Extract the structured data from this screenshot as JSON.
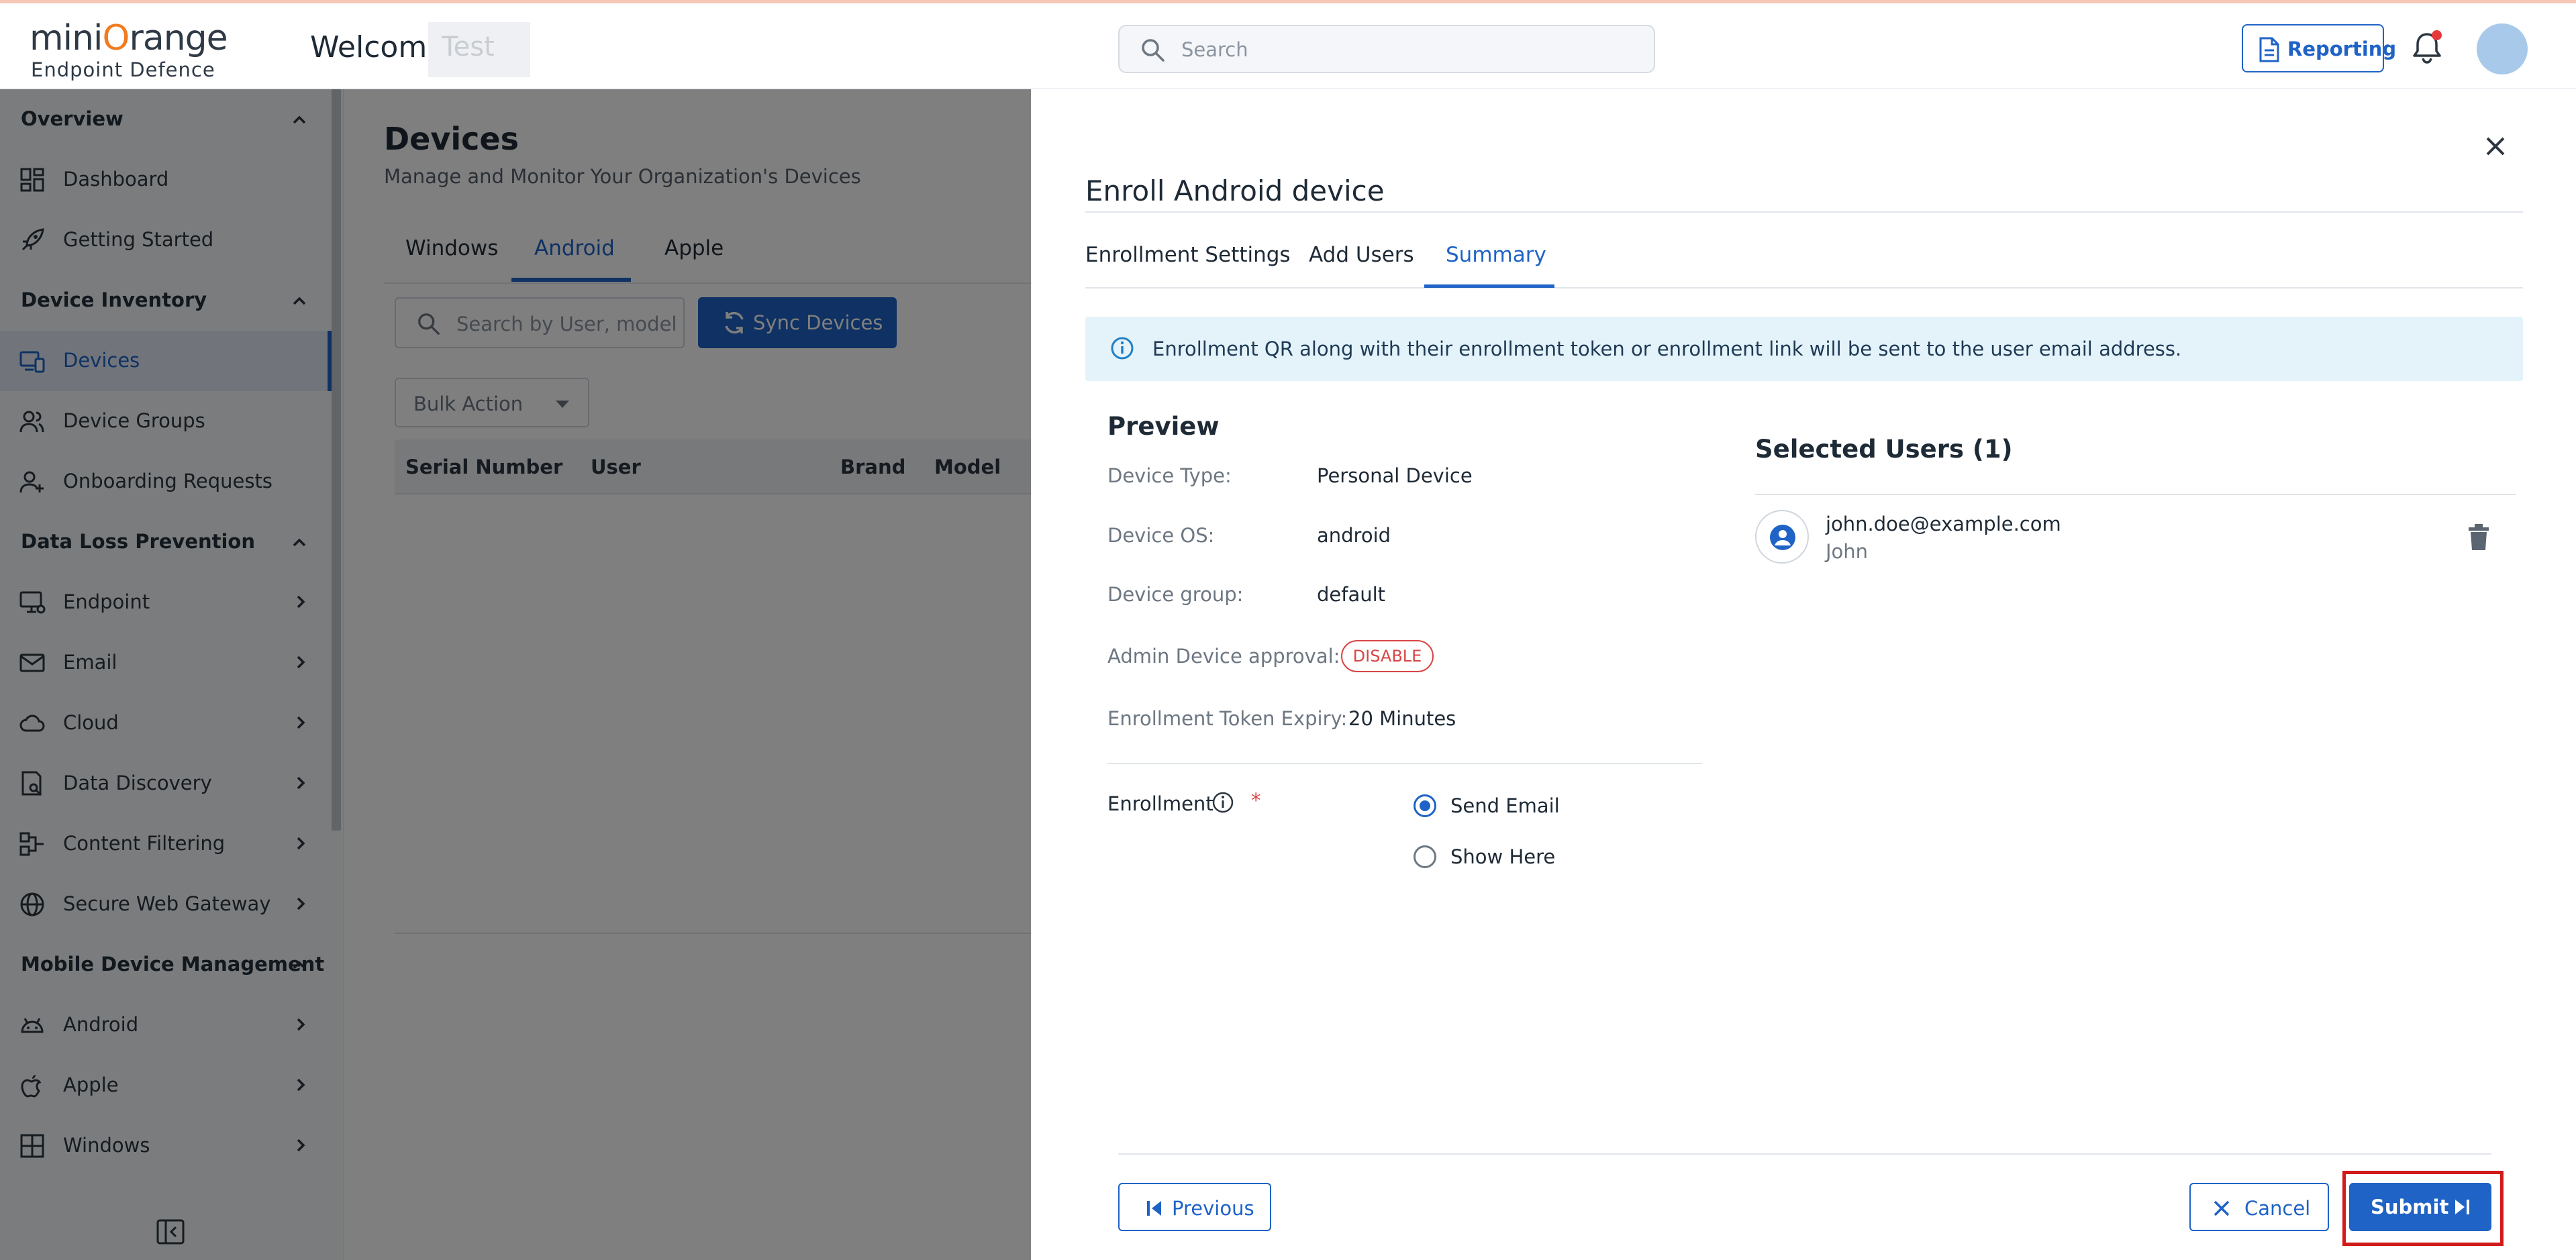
{
  "header": {
    "logo_brand_pre": "mini",
    "logo_brand_o": "O",
    "logo_brand_post": "range",
    "logo_sub": "Endpoint Defence",
    "welcome": "Welcome",
    "user_name": "Test",
    "search_placeholder": "Search",
    "reporting_label": "Reporting"
  },
  "sidebar": {
    "sections": {
      "overview": "Overview",
      "inventory": "Device Inventory",
      "dlp": "Data Loss Prevention",
      "mdm": "Mobile Device Management"
    },
    "items": {
      "dashboard": "Dashboard",
      "getting_started": "Getting Started",
      "devices": "Devices",
      "device_groups": "Device Groups",
      "onboarding": "Onboarding Requests",
      "endpoint": "Endpoint",
      "email": "Email",
      "cloud": "Cloud",
      "data_discovery": "Data Discovery",
      "content_filtering": "Content Filtering",
      "swg": "Secure Web Gateway",
      "android": "Android",
      "apple": "Apple",
      "windows": "Windows"
    },
    "active_item": "devices"
  },
  "main": {
    "title": "Devices",
    "subtitle": "Manage and Monitor Your Organization's Devices",
    "tabs": [
      "Windows",
      "Android",
      "Apple"
    ],
    "active_tab": "Android",
    "search_placeholder": "Search by User, model and serial number",
    "sync_label": "Sync Devices",
    "bulk_action": "Bulk Action",
    "columns": [
      "Serial Number",
      "User",
      "Brand",
      "Model"
    ]
  },
  "drawer": {
    "title": "Enroll Android device",
    "tabs": [
      "Enrollment Settings",
      "Add Users",
      "Summary"
    ],
    "active_tab": "Summary",
    "info_text": "Enrollment QR along with their enrollment token or enrollment link will be sent to the user email address.",
    "preview": {
      "title": "Preview",
      "device_type_label": "Device Type:",
      "device_type": "Personal Device",
      "device_os_label": "Device OS:",
      "device_os": "android",
      "device_group_label": "Device group:",
      "device_group": "default",
      "admin_approval_label": "Admin Device approval:",
      "admin_approval": "DISABLE",
      "token_expiry_label": "Enrollment Token Expiry:",
      "token_expiry": "20 Minutes",
      "enrollment_label": "Enrollment",
      "required_mark": "*",
      "options": [
        "Send Email",
        "Show Here"
      ],
      "selected_option": "Send Email"
    },
    "selected_users": {
      "title": "Selected Users (1)",
      "users": [
        {
          "email": "john.doe@example.com",
          "name": "John"
        }
      ]
    },
    "footer": {
      "previous": "Previous",
      "cancel": "Cancel",
      "submit": "Submit"
    }
  },
  "colors": {
    "primary": "#1f63c6",
    "danger": "#d84545",
    "highlight_frame": "#d11a1a",
    "info_bg": "#e4f3fa"
  }
}
